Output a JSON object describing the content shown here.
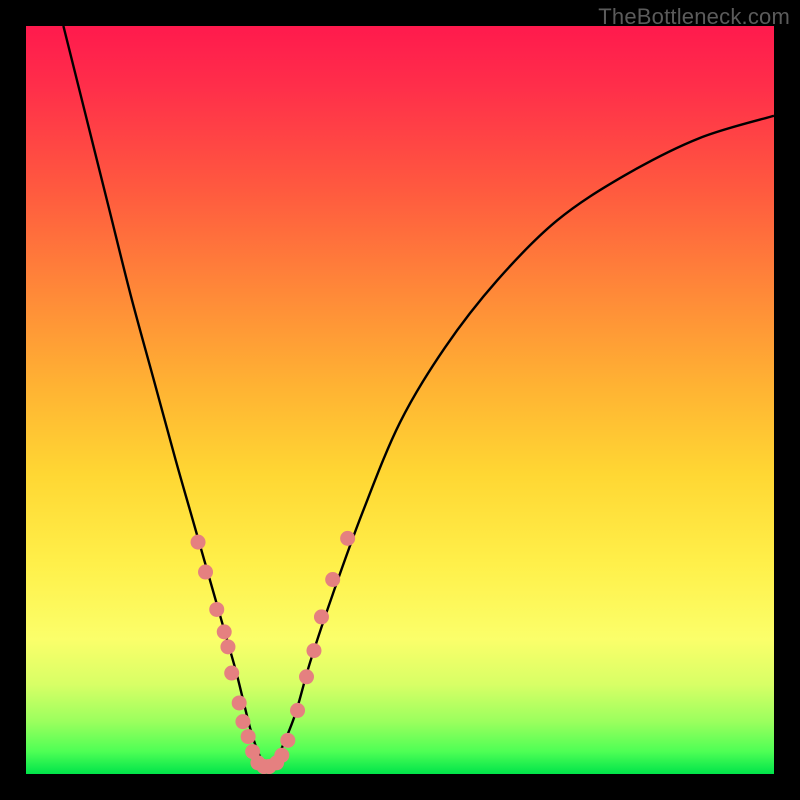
{
  "watermark": "TheBottleneck.com",
  "colors": {
    "curve_stroke": "#000000",
    "marker_fill": "#e58080",
    "marker_stroke": "#c96a6a",
    "gradient_top": "#ff1a4d",
    "gradient_bottom": "#00e44a"
  },
  "chart_data": {
    "type": "line",
    "title": "",
    "xlabel": "",
    "ylabel": "",
    "xlim": [
      0,
      100
    ],
    "ylim": [
      0,
      100
    ],
    "grid": false,
    "legend": false,
    "series": [
      {
        "name": "bottleneck-curve",
        "x": [
          5,
          8,
          11,
          14,
          17,
          20,
          22,
          24,
          26,
          28,
          29,
          30,
          31,
          32,
          33,
          34,
          36,
          38,
          41,
          45,
          50,
          56,
          63,
          71,
          80,
          90,
          100
        ],
        "y": [
          100,
          88,
          76,
          64,
          53,
          42,
          35,
          28,
          21,
          14,
          10,
          6,
          3,
          1,
          1,
          3,
          8,
          15,
          24,
          35,
          47,
          57,
          66,
          74,
          80,
          85,
          88
        ]
      }
    ],
    "markers": {
      "name": "highlight-points",
      "x": [
        23.0,
        24.0,
        25.5,
        26.5,
        27.0,
        27.5,
        28.5,
        29.0,
        29.7,
        30.3,
        31.0,
        31.8,
        32.5,
        33.5,
        34.2,
        35.0,
        36.3,
        37.5,
        38.5,
        39.5,
        41.0,
        43.0
      ],
      "y": [
        31.0,
        27.0,
        22.0,
        19.0,
        17.0,
        13.5,
        9.5,
        7.0,
        5.0,
        3.0,
        1.5,
        1.0,
        1.0,
        1.5,
        2.5,
        4.5,
        8.5,
        13.0,
        16.5,
        21.0,
        26.0,
        31.5
      ]
    }
  }
}
